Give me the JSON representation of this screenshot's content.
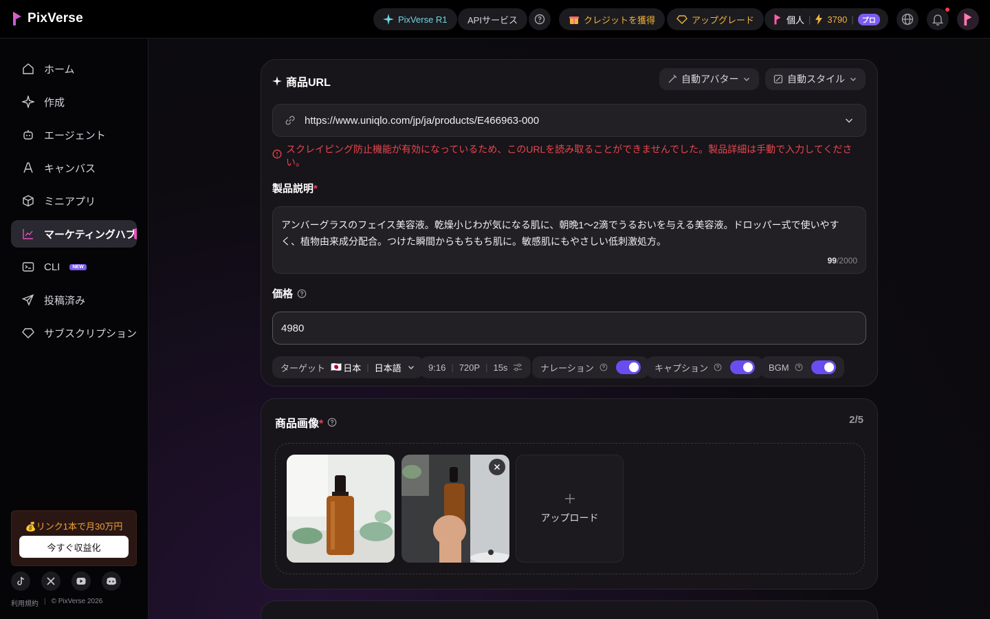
{
  "brand": {
    "name": "PixVerse"
  },
  "topbar": {
    "r1_label": "PixVerse R1",
    "api_label": "APIサービス",
    "credits_label": "クレジットを獲得",
    "upgrade_label": "アップグレード",
    "account_label": "個人",
    "credit_count": "3790",
    "pro_label": "プロ"
  },
  "sidebar": {
    "items": [
      {
        "label": "ホーム"
      },
      {
        "label": "作成"
      },
      {
        "label": "エージェント"
      },
      {
        "label": "キャンバス"
      },
      {
        "label": "ミニアプリ"
      },
      {
        "label": "マーケティングハブ"
      },
      {
        "label": "CLI",
        "badge": "NEW"
      },
      {
        "label": "投稿済み"
      },
      {
        "label": "サブスクリプション"
      }
    ],
    "promo": {
      "text": "💰リンク1本で月30万円",
      "button": "今すぐ収益化"
    },
    "footer": {
      "terms": "利用規約",
      "copyright": "© PixVerse 2026"
    }
  },
  "url_card": {
    "title": "商品URL",
    "avatar_label": "自動アバター",
    "style_label": "自動スタイル",
    "url_value": "https://www.uniqlo.com/jp/ja/products/E466963-000",
    "error": "スクレイピング防止機能が有効になっているため、このURLを読み取ることができませんでした。製品詳細は手動で入力してください。",
    "desc_label": "製品説明",
    "desc_value": "アンバーグラスのフェイス美容液。乾燥小じわが気になる肌に、朝晩1〜2滴でうるおいを与える美容液。ドロッパー式で使いやすく、植物由来成分配合。つけた瞬間からもちもち肌に。敏感肌にもやさしい低刺激処方。",
    "desc_count": "99",
    "desc_max": "/2000",
    "price_label": "価格",
    "price_value": "4980",
    "options": {
      "target_label": "ターゲット",
      "flag": "🇯🇵",
      "country": "日本",
      "language": "日本語",
      "ratio": "9:16",
      "resolution": "720P",
      "duration": "15s",
      "narration_label": "ナレーション",
      "caption_label": "キャプション",
      "bgm_label": "BGM"
    }
  },
  "image_card": {
    "title": "商品画像",
    "count": "2/5",
    "upload_label": "アップロード"
  },
  "colors": {
    "accent": "#6a4df0",
    "error": "#e5484d",
    "gold": "#f0b33d"
  }
}
